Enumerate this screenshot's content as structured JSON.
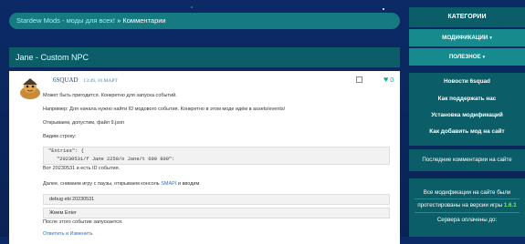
{
  "breadcrumb": {
    "site": "Stardew Mods - моды для всех!",
    "separator": "»",
    "current": "Комментарии"
  },
  "post": {
    "title": "Jane - Custom NPC"
  },
  "comment": {
    "author": "6SQUAD",
    "time": "13:49, 10 МАРТ",
    "likes": "0",
    "lines": [
      "Может быть пригодится. Конкретно для запуска событий.",
      "Например: Для начала нужно найти ID модового события. Конкретно в этом моде идём в assets/events/",
      "Открываем, допустим, файл 9.json",
      "Видим строку:"
    ],
    "code_lines": [
      "\"Entries\": {",
      "\"20230531/f Jane 2250/o Jane/t 600 800\":"
    ],
    "after_code": "Вот 20230531 и есть ID события.",
    "smapi_sentence_pre": "Далее, снимаем игру с паузы, открываем консоль",
    "smapi_link": "SMAPI",
    "smapi_sentence_post": "и вводим",
    "command": "debug ebi 20230531",
    "enter": "Жмем Enter",
    "final": "После этого событие запускается.",
    "reply": "Ответить и Изменить"
  },
  "sidebar": {
    "categories_title": "КАТЕГОРИИ",
    "menu": [
      {
        "label": "МОДИФИКАЦИИ"
      },
      {
        "label": "ПОЛЕЗНОЕ"
      }
    ],
    "links": [
      "Новости 6squad",
      "Как поддержать нас",
      "Установка модификаций",
      "Как добавить мод на сайт"
    ],
    "latest_comments": "Последние комментарии на сайте",
    "notice_line1": "Все модификации на сайте были",
    "notice_line2_pre": "протестированы на версии игры",
    "notice_version": "1.6.1",
    "notice_line3": "Сервера оплачены до:"
  }
}
